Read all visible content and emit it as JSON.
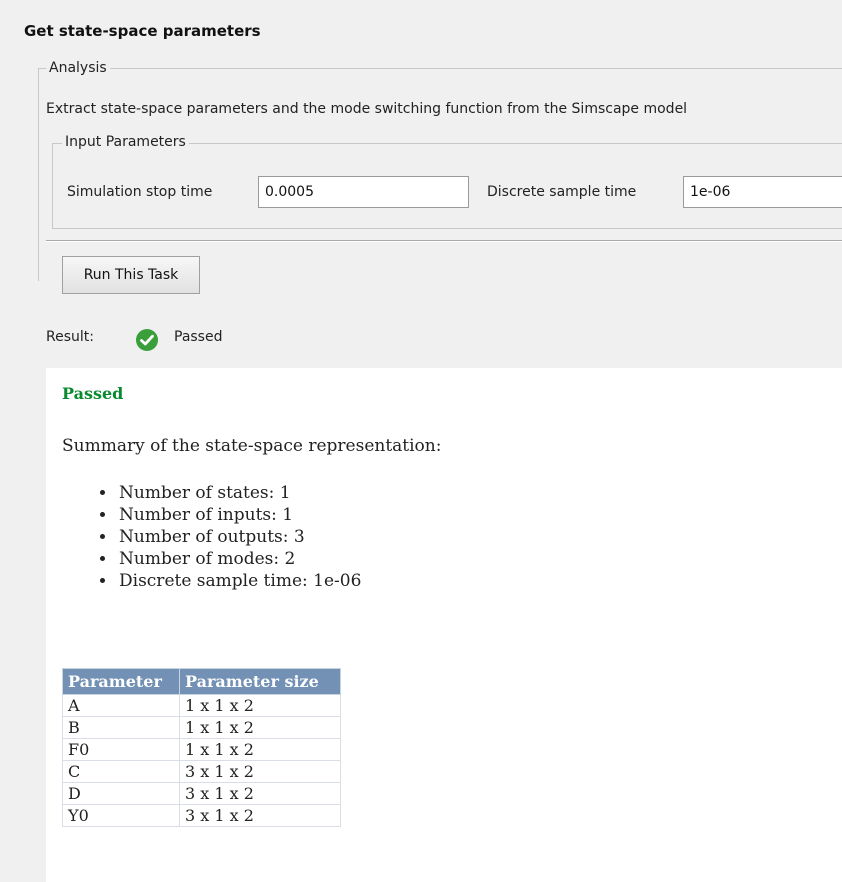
{
  "task": {
    "title": "Get state-space parameters"
  },
  "analysis": {
    "legend": "Analysis",
    "description": "Extract state-space parameters and the mode switching function from the Simscape model"
  },
  "input_parameters": {
    "legend": "Input Parameters",
    "stop_time_label": "Simulation stop time",
    "stop_time_value": "0.0005",
    "sample_time_label": "Discrete sample time",
    "sample_time_value": "1e-06"
  },
  "run_button": {
    "label": "Run This Task"
  },
  "result": {
    "label": "Result:",
    "status": "Passed",
    "status_icon": "check-circle-icon",
    "status_color": "#3a9f3a"
  },
  "report": {
    "passed_heading": "Passed",
    "passed_color": "#0a8a2e",
    "summary": "Summary of the state-space representation:",
    "items": [
      "Number of states: 1",
      "Number of inputs: 1",
      "Number of outputs: 3",
      "Number of modes: 2",
      "Discrete sample time: 1e-06"
    ],
    "table": {
      "header_color": "#7291b4",
      "headers": [
        "Parameter",
        "Parameter size"
      ],
      "rows": [
        [
          "A",
          "1 x 1 x 2"
        ],
        [
          "B",
          "1 x 1 x 2"
        ],
        [
          "F0",
          "1 x 1 x 2"
        ],
        [
          "C",
          "3 x 1 x 2"
        ],
        [
          "D",
          "3 x 1 x 2"
        ],
        [
          "Y0",
          "3 x 1 x 2"
        ]
      ]
    }
  }
}
